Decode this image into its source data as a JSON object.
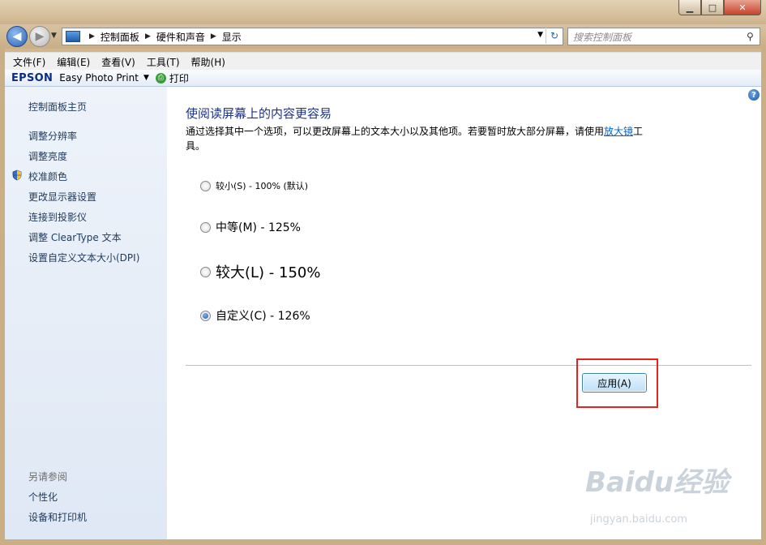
{
  "window": {
    "controls": {
      "minimize": "▁",
      "maximize": "□",
      "close": "✕"
    }
  },
  "nav": {
    "breadcrumb": [
      "控制面板",
      "硬件和声音",
      "显示"
    ],
    "search_placeholder": "搜索控制面板"
  },
  "menu": [
    "文件(F)",
    "编辑(E)",
    "查看(V)",
    "工具(T)",
    "帮助(H)"
  ],
  "toolbar": {
    "brand": "EPSON",
    "app": "Easy Photo Print",
    "print": "打印"
  },
  "sidebar": {
    "items": [
      "控制面板主页",
      "调整分辨率",
      "调整亮度",
      "校准颜色",
      "更改显示器设置",
      "连接到投影仪",
      "调整 ClearType 文本",
      "设置自定义文本大小(DPI)"
    ],
    "see_also_label": "另请参阅",
    "see_also": [
      "个性化",
      "设备和打印机"
    ]
  },
  "main": {
    "title": "使阅读屏幕上的内容更容易",
    "desc_before": "通过选择其中一个选项，可以更改屏幕上的文本大小以及其他项。若要暂时放大部分屏幕，请使用",
    "desc_link": "放大镜",
    "desc_after": "工具。",
    "options": [
      {
        "label": "较小(S) - 100% (默认)",
        "selected": false
      },
      {
        "label": "中等(M) - 125%",
        "selected": false
      },
      {
        "label": "较大(L) - 150%",
        "selected": false
      },
      {
        "label": "自定义(C) - 126%",
        "selected": true
      }
    ],
    "apply": "应用(A)"
  },
  "watermark": {
    "brand": "Baidu经验",
    "url": "jingyan.baidu.com"
  }
}
